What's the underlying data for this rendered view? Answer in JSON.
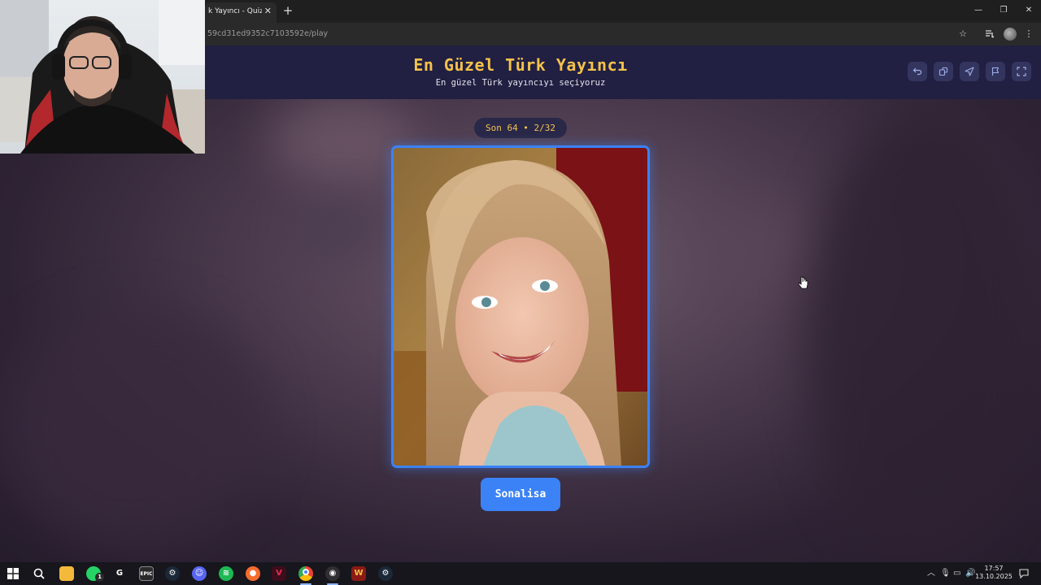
{
  "browser": {
    "tab_title": "k Yayıncı - Quizei",
    "tab_close": "✕",
    "new_tab": "+",
    "url": "59cd31ed9352c7103592e/play",
    "window_controls": {
      "minimize": "—",
      "restore": "❐",
      "close": "✕"
    },
    "icons": [
      "star-icon",
      "media-icon",
      "profile-avatar",
      "menu-icon"
    ]
  },
  "app": {
    "title": "En Güzel Türk Yayıncı",
    "subtitle": "En güzel Türk yayıncıyı seçiyoruz",
    "round": "Son 64 • 2/32",
    "contestant_name": "Sonalisa",
    "header_buttons": [
      "undo-icon",
      "share-icon",
      "send-icon",
      "flag-icon",
      "fullscreen-icon"
    ],
    "colors": {
      "accent": "#3b82f6",
      "title": "#f5c24c",
      "header_bg": "#212042"
    }
  },
  "taskbar": {
    "apps": [
      "windows-start-icon",
      "search-icon",
      "file-explorer-icon",
      "whatsapp-icon",
      "logitech-g-icon",
      "epic-games-icon",
      "steam-icon",
      "discord-icon",
      "spotify-icon",
      "origin-icon",
      "app-v-icon",
      "chrome-icon",
      "obs-icon",
      "app-w-icon",
      "steam-icon"
    ],
    "whatsapp_badge": "1",
    "time": "17:57",
    "date": "13.10.2025"
  }
}
